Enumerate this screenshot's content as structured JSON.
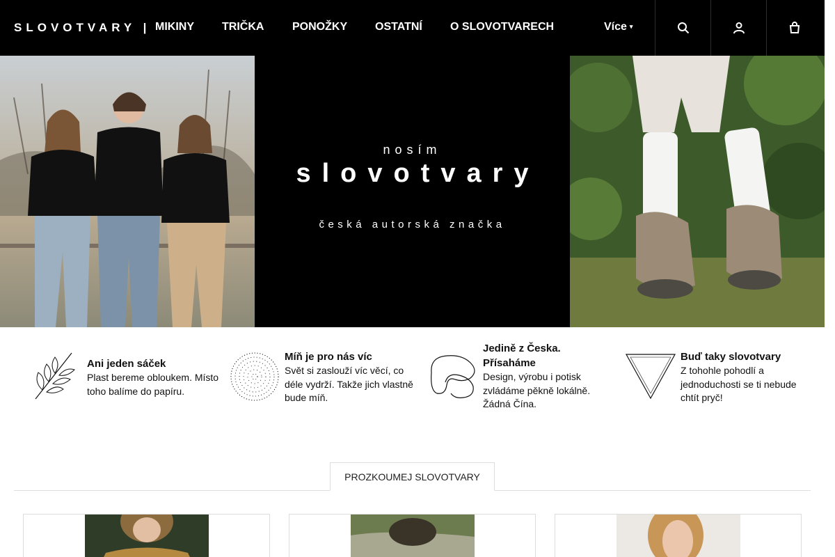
{
  "header": {
    "logo": "SLOVOTVARY  |",
    "nav": [
      {
        "label": "MIKINY"
      },
      {
        "label": "TRIČKA"
      },
      {
        "label": "PONOŽKY"
      },
      {
        "label": "OSTATNÍ"
      },
      {
        "label": "O SLOVOTVARECH"
      }
    ],
    "more_label": "Více",
    "icons": [
      "search-icon",
      "user-icon",
      "cart-icon"
    ],
    "background": "#000000"
  },
  "hero": {
    "pre_title": "nosím",
    "title": "slovotvary",
    "subtitle": "česká autorská značka"
  },
  "features": [
    {
      "icon": "leaf-icon",
      "title": "Ani jeden sáček",
      "text": "Plast bereme obloukem. Místo toho balíme do papíru."
    },
    {
      "icon": "dotted-circle-icon",
      "title": "Míň je pro nás víc",
      "text": "Svět si zaslouží víc věcí, co déle vydrží. Takže jich vlastně bude míň."
    },
    {
      "icon": "blob-shape-icon",
      "title": "Jedině z Česka. Přísaháme",
      "text": "Design, výrobu i potisk zvládáme pěkně lokálně. Žádná Čína."
    },
    {
      "icon": "triangle-icon",
      "title": "Buď taky slovotvary",
      "text": "Z tohohle pohodlí a jednoduchosti se ti nebude chtít pryč!"
    }
  ],
  "explore": {
    "label": "PROZKOUMEJ SLOVOTVARY"
  }
}
